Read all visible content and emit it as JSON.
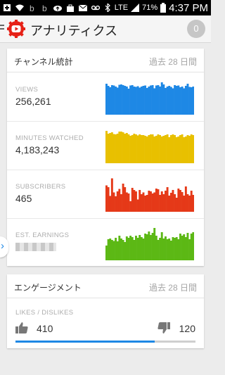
{
  "status_bar": {
    "time": "4:37 PM",
    "battery_pct": "71%",
    "network": "LTE",
    "icons": [
      "plus-icon",
      "wifi-icon",
      "b-icon",
      "b-icon",
      "cloud-upload-icon",
      "bag-icon",
      "gmail-icon",
      "voicemail-icon",
      "bluetooth-icon",
      "lte-icon",
      "signal-icon",
      "battery-icon"
    ]
  },
  "app_bar": {
    "title": "アナリティクス",
    "notif_count": "0"
  },
  "channel_card": {
    "title": "チャンネル統計",
    "period": "過去 28 日間",
    "metrics": [
      {
        "label": "VIEWS",
        "value": "256,261",
        "color": "#1e88e5",
        "spark": [
          88,
          82,
          78,
          84,
          83,
          80,
          77,
          85,
          86,
          84,
          82,
          80,
          74,
          83,
          84,
          80,
          79,
          81,
          77,
          80,
          82,
          83,
          76,
          80,
          83,
          84,
          75,
          83,
          84,
          80,
          92,
          86,
          76,
          80,
          82,
          79,
          75,
          84,
          82,
          83,
          78,
          80,
          75,
          82,
          88,
          79,
          78,
          80
        ]
      },
      {
        "label": "MINUTES WATCHED",
        "value": "4,183,243",
        "color": "#e8c000",
        "spark": [
          92,
          84,
          86,
          88,
          83,
          82,
          84,
          90,
          90,
          88,
          84,
          86,
          82,
          78,
          80,
          84,
          82,
          79,
          82,
          80,
          80,
          78,
          76,
          80,
          82,
          82,
          76,
          78,
          82,
          80,
          76,
          78,
          80,
          82,
          74,
          80,
          82,
          80,
          74,
          76,
          80,
          82,
          74,
          76,
          80,
          78,
          82,
          80
        ]
      },
      {
        "label": "SUBSCRIBERS",
        "value": "465",
        "color": "#e53918",
        "spark": [
          75,
          70,
          45,
          95,
          55,
          44,
          58,
          65,
          50,
          80,
          70,
          55,
          52,
          30,
          68,
          62,
          58,
          35,
          62,
          50,
          55,
          46,
          48,
          60,
          58,
          52,
          55,
          66,
          64,
          48,
          58,
          50,
          60,
          70,
          46,
          54,
          62,
          50,
          40,
          66,
          62,
          56,
          46,
          72,
          50,
          46,
          60,
          48
        ]
      },
      {
        "label": "EST. EARNINGS",
        "value": "",
        "color": "#5cb815",
        "spark": [
          42,
          60,
          62,
          58,
          55,
          64,
          54,
          70,
          62,
          58,
          52,
          68,
          64,
          70,
          66,
          58,
          70,
          64,
          72,
          66,
          62,
          76,
          74,
          82,
          72,
          78,
          92,
          70,
          58,
          64,
          80,
          62,
          68,
          60,
          62,
          56,
          66,
          64,
          66,
          60,
          76,
          70,
          74,
          66,
          78,
          60,
          76,
          80
        ]
      }
    ]
  },
  "engagement_card": {
    "title": "エンゲージメント",
    "period": "過去 28 日間",
    "label": "LIKES / DISLIKES",
    "likes": "410",
    "dislikes": "120",
    "like_ratio": 0.774
  }
}
